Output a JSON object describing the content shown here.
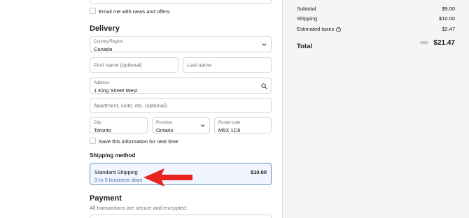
{
  "checkout": {
    "email_opt_in": "Email me with news and offers",
    "delivery_heading": "Delivery",
    "country": {
      "label": "Country/Region",
      "value": "Canada"
    },
    "first_name": {
      "placeholder": "First name (optional)"
    },
    "last_name": {
      "placeholder": "Last name"
    },
    "address": {
      "label": "Address",
      "value": "1 King Street West"
    },
    "apartment": {
      "placeholder": "Apartment, suite, etc. (optional)"
    },
    "city": {
      "label": "City",
      "value": "Toronto"
    },
    "province": {
      "label": "Province",
      "value": "Ontario"
    },
    "postal": {
      "label": "Postal code",
      "value": "M5X 1C8"
    },
    "save_info": "Save this information for next time",
    "shipping_heading": "Shipping method",
    "shipping_option": {
      "name": "Standard Shipping",
      "days": "3 to 5 business days",
      "price": "$10.00"
    },
    "payment_heading": "Payment",
    "payment_note": "All transactions are secure and encrypted."
  },
  "summary": {
    "subtotal_label": "Subtotal",
    "subtotal": "$9.00",
    "shipping_label": "Shipping",
    "shipping": "$10.00",
    "taxes_label": "Estimated taxes",
    "taxes": "$2.47",
    "total_label": "Total",
    "currency": "USD",
    "total": "$21.47"
  },
  "colors": {
    "accent": "#6f94c2",
    "arrow": "#e8241c",
    "summary_bg": "#f5f5f5"
  },
  "icons": [
    "chevron-down-icon",
    "search-icon",
    "info-icon",
    "arrow-annotation"
  ]
}
